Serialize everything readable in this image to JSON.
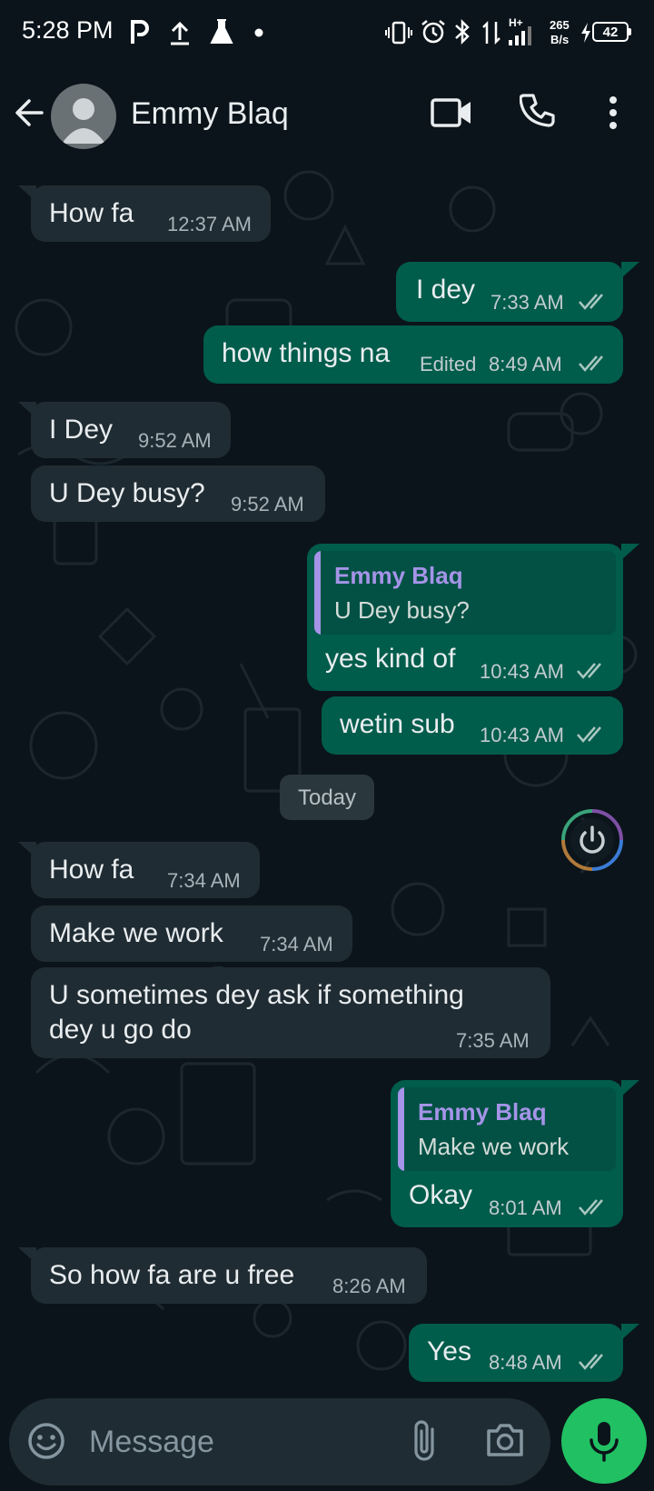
{
  "status_bar": {
    "time": "5:28 PM",
    "network_speed_value": "265",
    "network_speed_unit": "B/s",
    "battery": "42",
    "net_type": "H+"
  },
  "header": {
    "contact_name": "Emmy Blaq",
    "icons": [
      "back-arrow-icon",
      "avatar",
      "video-call-icon",
      "phone-icon",
      "more-vert-icon"
    ]
  },
  "messages": [
    {
      "dir": "in",
      "text": "How fa",
      "time": "12:37 AM"
    },
    {
      "dir": "out",
      "text": "I dey",
      "time": "7:33 AM",
      "status": "read"
    },
    {
      "dir": "out",
      "text": "how things na",
      "edited": "Edited",
      "time": "8:49 AM",
      "status": "read"
    },
    {
      "dir": "in",
      "text": "I Dey",
      "time": "9:52 AM"
    },
    {
      "dir": "in",
      "text": "U Dey busy?",
      "time": "9:52 AM"
    },
    {
      "dir": "out",
      "quote_name": "Emmy Blaq",
      "quote_text": "U Dey busy?",
      "text": "yes kind of",
      "time": "10:43 AM",
      "status": "read"
    },
    {
      "dir": "out",
      "text": "wetin sub",
      "time": "10:43 AM",
      "status": "read"
    },
    {
      "dir": "in",
      "text": "How fa",
      "time": "7:34 AM"
    },
    {
      "dir": "in",
      "text": "Make we work",
      "time": "7:34 AM"
    },
    {
      "dir": "in",
      "text_line1": "U sometimes dey ask if something",
      "text_line2": "dey u go do",
      "time": "7:35 AM"
    },
    {
      "dir": "out",
      "quote_name": "Emmy Blaq",
      "quote_text": "Make we work",
      "text": "Okay",
      "time": "8:01 AM",
      "status": "read"
    },
    {
      "dir": "in",
      "text": "So how fa are u free",
      "time": "8:26 AM"
    },
    {
      "dir": "out",
      "text": "Yes",
      "time": "8:48 AM",
      "status": "read"
    }
  ],
  "date_separator": "Today",
  "composer": {
    "placeholder": "Message"
  },
  "colors": {
    "background": "#0b141a",
    "incoming_bubble": "#202c33",
    "outgoing_bubble": "#005c4b",
    "quote_accent": "#a594e8",
    "read_ticks": "#a9c7c0",
    "mic_button": "#21c063"
  }
}
